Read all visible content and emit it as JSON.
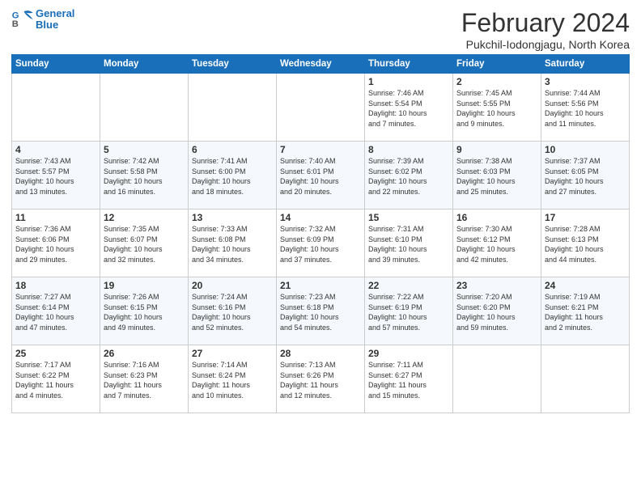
{
  "logo": {
    "line1": "General",
    "line2": "Blue"
  },
  "title": "February 2024",
  "location": "Pukchil-Iodongjagu, North Korea",
  "days_header": [
    "Sunday",
    "Monday",
    "Tuesday",
    "Wednesday",
    "Thursday",
    "Friday",
    "Saturday"
  ],
  "weeks": [
    [
      {
        "num": "",
        "info": ""
      },
      {
        "num": "",
        "info": ""
      },
      {
        "num": "",
        "info": ""
      },
      {
        "num": "",
        "info": ""
      },
      {
        "num": "1",
        "info": "Sunrise: 7:46 AM\nSunset: 5:54 PM\nDaylight: 10 hours\nand 7 minutes."
      },
      {
        "num": "2",
        "info": "Sunrise: 7:45 AM\nSunset: 5:55 PM\nDaylight: 10 hours\nand 9 minutes."
      },
      {
        "num": "3",
        "info": "Sunrise: 7:44 AM\nSunset: 5:56 PM\nDaylight: 10 hours\nand 11 minutes."
      }
    ],
    [
      {
        "num": "4",
        "info": "Sunrise: 7:43 AM\nSunset: 5:57 PM\nDaylight: 10 hours\nand 13 minutes."
      },
      {
        "num": "5",
        "info": "Sunrise: 7:42 AM\nSunset: 5:58 PM\nDaylight: 10 hours\nand 16 minutes."
      },
      {
        "num": "6",
        "info": "Sunrise: 7:41 AM\nSunset: 6:00 PM\nDaylight: 10 hours\nand 18 minutes."
      },
      {
        "num": "7",
        "info": "Sunrise: 7:40 AM\nSunset: 6:01 PM\nDaylight: 10 hours\nand 20 minutes."
      },
      {
        "num": "8",
        "info": "Sunrise: 7:39 AM\nSunset: 6:02 PM\nDaylight: 10 hours\nand 22 minutes."
      },
      {
        "num": "9",
        "info": "Sunrise: 7:38 AM\nSunset: 6:03 PM\nDaylight: 10 hours\nand 25 minutes."
      },
      {
        "num": "10",
        "info": "Sunrise: 7:37 AM\nSunset: 6:05 PM\nDaylight: 10 hours\nand 27 minutes."
      }
    ],
    [
      {
        "num": "11",
        "info": "Sunrise: 7:36 AM\nSunset: 6:06 PM\nDaylight: 10 hours\nand 29 minutes."
      },
      {
        "num": "12",
        "info": "Sunrise: 7:35 AM\nSunset: 6:07 PM\nDaylight: 10 hours\nand 32 minutes."
      },
      {
        "num": "13",
        "info": "Sunrise: 7:33 AM\nSunset: 6:08 PM\nDaylight: 10 hours\nand 34 minutes."
      },
      {
        "num": "14",
        "info": "Sunrise: 7:32 AM\nSunset: 6:09 PM\nDaylight: 10 hours\nand 37 minutes."
      },
      {
        "num": "15",
        "info": "Sunrise: 7:31 AM\nSunset: 6:10 PM\nDaylight: 10 hours\nand 39 minutes."
      },
      {
        "num": "16",
        "info": "Sunrise: 7:30 AM\nSunset: 6:12 PM\nDaylight: 10 hours\nand 42 minutes."
      },
      {
        "num": "17",
        "info": "Sunrise: 7:28 AM\nSunset: 6:13 PM\nDaylight: 10 hours\nand 44 minutes."
      }
    ],
    [
      {
        "num": "18",
        "info": "Sunrise: 7:27 AM\nSunset: 6:14 PM\nDaylight: 10 hours\nand 47 minutes."
      },
      {
        "num": "19",
        "info": "Sunrise: 7:26 AM\nSunset: 6:15 PM\nDaylight: 10 hours\nand 49 minutes."
      },
      {
        "num": "20",
        "info": "Sunrise: 7:24 AM\nSunset: 6:16 PM\nDaylight: 10 hours\nand 52 minutes."
      },
      {
        "num": "21",
        "info": "Sunrise: 7:23 AM\nSunset: 6:18 PM\nDaylight: 10 hours\nand 54 minutes."
      },
      {
        "num": "22",
        "info": "Sunrise: 7:22 AM\nSunset: 6:19 PM\nDaylight: 10 hours\nand 57 minutes."
      },
      {
        "num": "23",
        "info": "Sunrise: 7:20 AM\nSunset: 6:20 PM\nDaylight: 10 hours\nand 59 minutes."
      },
      {
        "num": "24",
        "info": "Sunrise: 7:19 AM\nSunset: 6:21 PM\nDaylight: 11 hours\nand 2 minutes."
      }
    ],
    [
      {
        "num": "25",
        "info": "Sunrise: 7:17 AM\nSunset: 6:22 PM\nDaylight: 11 hours\nand 4 minutes."
      },
      {
        "num": "26",
        "info": "Sunrise: 7:16 AM\nSunset: 6:23 PM\nDaylight: 11 hours\nand 7 minutes."
      },
      {
        "num": "27",
        "info": "Sunrise: 7:14 AM\nSunset: 6:24 PM\nDaylight: 11 hours\nand 10 minutes."
      },
      {
        "num": "28",
        "info": "Sunrise: 7:13 AM\nSunset: 6:26 PM\nDaylight: 11 hours\nand 12 minutes."
      },
      {
        "num": "29",
        "info": "Sunrise: 7:11 AM\nSunset: 6:27 PM\nDaylight: 11 hours\nand 15 minutes."
      },
      {
        "num": "",
        "info": ""
      },
      {
        "num": "",
        "info": ""
      }
    ]
  ]
}
